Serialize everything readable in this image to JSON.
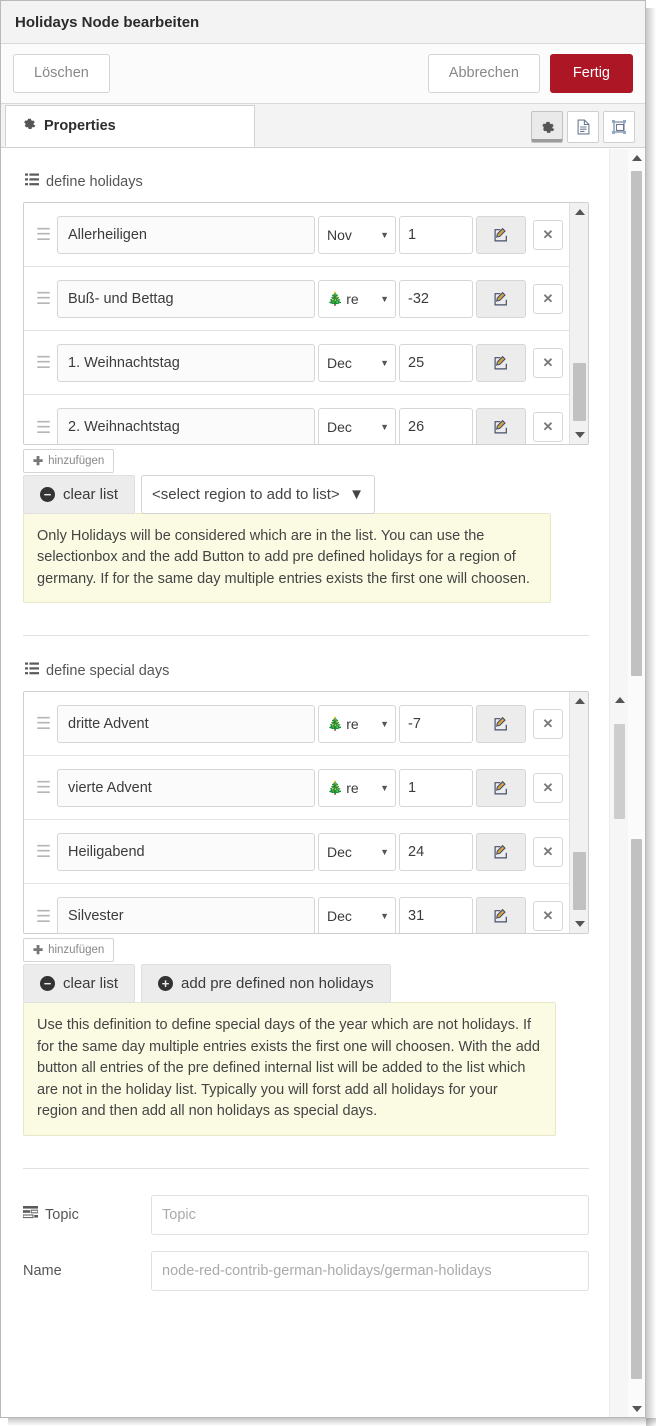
{
  "dialog": {
    "title": "Holidays Node bearbeiten",
    "buttons": {
      "delete": "Löschen",
      "cancel": "Abbrechen",
      "done": "Fertig"
    },
    "accent_color": "#ad1625"
  },
  "tabs": {
    "active": "Properties",
    "items": [
      {
        "label": "Properties",
        "icon": "gear-icon"
      }
    ],
    "icon_buttons": [
      {
        "name": "properties-tab-icon",
        "icon": "gear-icon",
        "active": true
      },
      {
        "name": "description-tab-icon",
        "icon": "document-icon",
        "active": false
      },
      {
        "name": "appearance-tab-icon",
        "icon": "appearance-icon",
        "active": false
      }
    ]
  },
  "holidays": {
    "heading": "define holidays",
    "heading_icon": "list-icon",
    "rows": [
      {
        "name": "Allerheiligen",
        "month": "Nov",
        "month_icon": "",
        "day": "1"
      },
      {
        "name": "Buß- und Bettag",
        "month": "re",
        "month_icon": "christmas-tree-icon",
        "day": "-32"
      },
      {
        "name": "1. Weihnachtstag",
        "month": "Dec",
        "month_icon": "",
        "day": "25"
      },
      {
        "name": "2. Weihnachtstag",
        "month": "Dec",
        "month_icon": "",
        "day": "26"
      }
    ],
    "add_label": "hinzufügen",
    "clear_label": "clear list",
    "region_select_value": "<select region to add to list>",
    "info": "Only Holidays will be considered which are in the list. You can use the selectionbox and the add Button to add pre defined holidays for a region of germany. If for the same day multiple entries exists the first one will choosen."
  },
  "special_days": {
    "heading": "define special days",
    "heading_icon": "list-icon",
    "rows": [
      {
        "name": "dritte Advent",
        "month": "re",
        "month_icon": "christmas-tree-icon",
        "day": "-7"
      },
      {
        "name": "vierte Advent",
        "month": "re",
        "month_icon": "christmas-tree-icon",
        "day": "1"
      },
      {
        "name": "Heiligabend",
        "month": "Dec",
        "month_icon": "",
        "day": "24"
      },
      {
        "name": "Silvester",
        "month": "Dec",
        "month_icon": "",
        "day": "31"
      }
    ],
    "add_label": "hinzufügen",
    "clear_label": "clear list",
    "add_predefined_label": "add pre defined non holidays",
    "info": "Use this definition to define special days of the year which are not holidays. If for the same day multiple entries exists the first one will choosen. With the add button all entries of the pre defined internal list will be added to the list which are not in the holiday list. Typically you will forst add all holidays for your region and then add all non holidays as special days."
  },
  "form": {
    "topic": {
      "label": "Topic",
      "icon": "tasks-icon",
      "value": "",
      "placeholder": "Topic"
    },
    "name": {
      "label": "Name",
      "value": "",
      "placeholder": "node-red-contrib-german-holidays/german-holidays"
    }
  }
}
